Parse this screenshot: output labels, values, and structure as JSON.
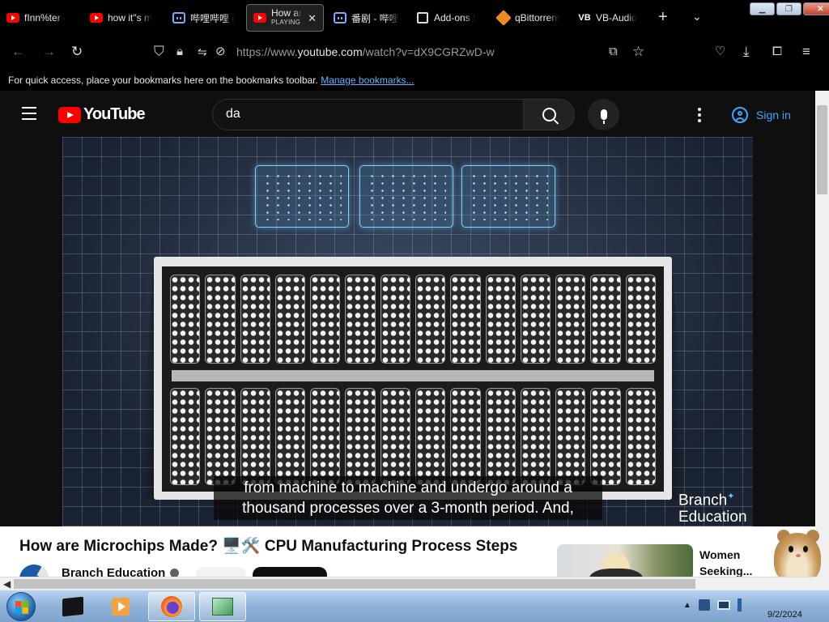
{
  "browser": {
    "tabs": [
      {
        "title": "fInn%ter -",
        "favicon": "youtube-icon",
        "active": false
      },
      {
        "title": "how it\"s m",
        "favicon": "youtube-icon",
        "active": false
      },
      {
        "title": "哔哩哔哩 (",
        "favicon": "bilibili-icon",
        "active": false
      },
      {
        "title": "How ar",
        "subtitle": "PLAYING",
        "favicon": "youtube-icon",
        "active": true
      },
      {
        "title": "番剧 - 哔哩",
        "favicon": "bilibili-icon",
        "active": false
      },
      {
        "title": "Add-ons f",
        "favicon": "puzzle-icon",
        "active": false
      },
      {
        "title": "qBittorrent",
        "favicon": "qbittorrent-icon",
        "active": false
      },
      {
        "title": "VB-Audio",
        "favicon": "vb-icon",
        "favicon_text": "VB",
        "active": false
      }
    ],
    "new_tab": "+",
    "tab_list": "⌄",
    "url_prefix": "https://www.",
    "url_host": "youtube.com",
    "url_rest": "/watch?v=dX9CGRZwD-w",
    "bookmarks_message": "For quick access, place your bookmarks here on the bookmarks toolbar.",
    "bookmarks_link": "Manage bookmarks..."
  },
  "youtube": {
    "logo_text": "YouTube",
    "search_value": "da",
    "sign_in": "Sign in",
    "caption_line1": "from machine to machine and undergo around a",
    "caption_line2": "thousand processes over a 3-month period. And,",
    "watermark_line1": "Branch",
    "watermark_line2": "Education",
    "video_title": "How are Microchips Made?",
    "video_title_emoji": "🖥️🛠️",
    "video_title_rest": "CPU Manufacturing Process Steps",
    "channel_name": "Branch Education",
    "recommended_title": "Women Seeking..."
  },
  "taskbar": {
    "date": "9/2/2024",
    "tray_expand": "▲"
  },
  "colors": {
    "youtube_red": "#ff0000",
    "link_blue": "#3ea6ff",
    "bookmark_link": "#5fb4ff"
  }
}
